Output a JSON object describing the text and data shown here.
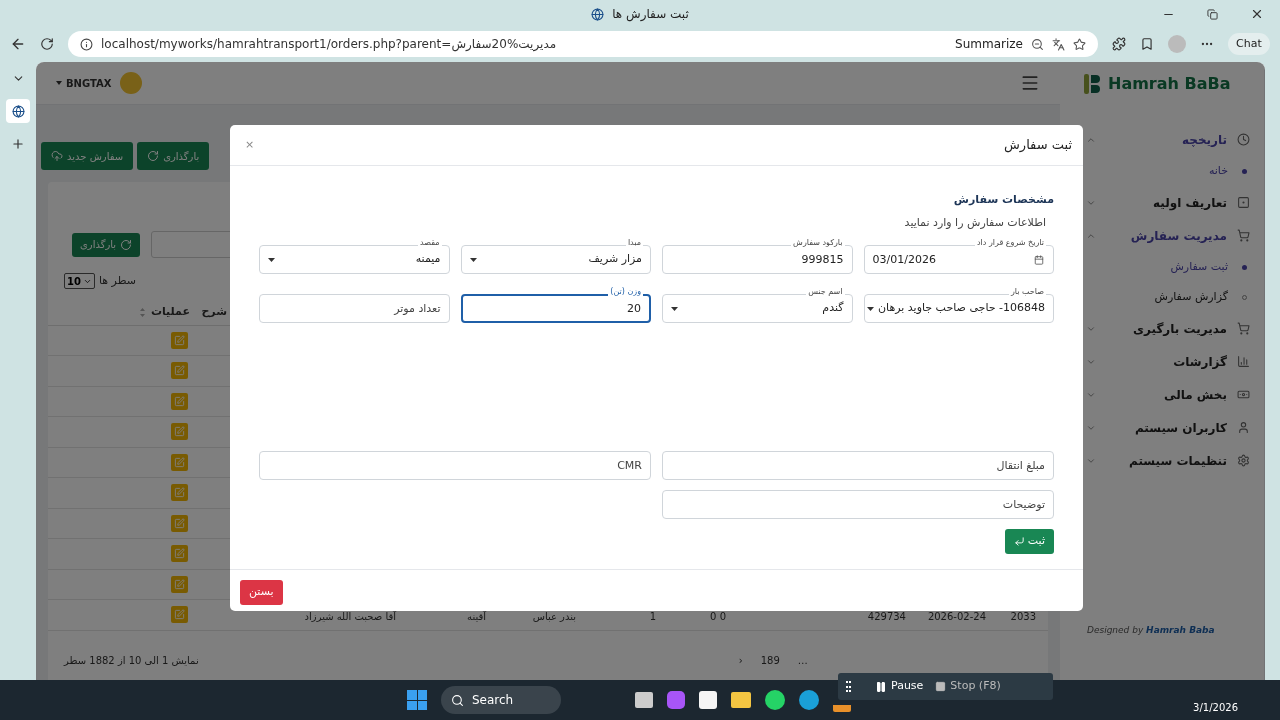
{
  "browser": {
    "title": "ثبت سفارش ها",
    "url": "localhost/myworks/hamrahtransport1/orders.php?parent=مدیریت%20سفارش",
    "summarize": "Summarize",
    "chat": "Chat"
  },
  "header": {
    "user": "BNGTAX",
    "logo": "Hamrah BaBa"
  },
  "toolbar": {
    "buttons": [
      {
        "label": "بارگذاری",
        "kind": "reload"
      },
      {
        "label": "سفارش جدید",
        "kind": "new"
      }
    ]
  },
  "table_controls": {
    "reload": "بارگذاری",
    "rows_per_page": "10",
    "rows_label": "سطر ها"
  },
  "table": {
    "columns": [
      {
        "label": "شرح"
      },
      {
        "label": "عملیات"
      }
    ],
    "rows": [
      {
        "kind": "edit"
      },
      {
        "kind": "edit"
      },
      {
        "kind": "edit"
      },
      {
        "kind": "edit"
      },
      {
        "kind": "edit"
      },
      {
        "kind": "edit"
      },
      {
        "kind": "edit"
      },
      {
        "kind": "edit"
      },
      {
        "kind": "edit"
      },
      {
        "kind": "edit",
        "cells": [
          "2033",
          "2026-02-24",
          "429734",
          "0 0",
          "1",
          "بندر عباس",
          "آقینه",
          "آقا صحبت الله شیرزاد"
        ]
      }
    ],
    "summary": "نمایش 1 الی 10 از 1882 سطر",
    "pagination": [
      "…",
      "189",
      "›"
    ]
  },
  "sidebar": {
    "items": [
      {
        "label": "تاریخچه",
        "expanded": true,
        "selected": true,
        "children": [
          {
            "label": "خانه",
            "selected": true
          }
        ]
      },
      {
        "label": "تعاریف اولیه",
        "expanded": false,
        "selected": false
      },
      {
        "label": "مدیریت سفارش",
        "expanded": true,
        "selected": true,
        "children": [
          {
            "label": "ثبت سفارش",
            "selected": true
          },
          {
            "label": "گزارش سفارش",
            "selected": false
          }
        ]
      },
      {
        "label": "مدیریت بارگیری",
        "expanded": false,
        "selected": false
      },
      {
        "label": "گزارشات",
        "expanded": false,
        "selected": false
      },
      {
        "label": "بخش مالی",
        "expanded": false,
        "selected": false
      },
      {
        "label": "کاربران سیستم",
        "expanded": false,
        "selected": false
      },
      {
        "label": "تنظیمات سیستم",
        "expanded": false,
        "selected": false
      }
    ],
    "footer_prefix": "Designed by",
    "footer_brand": "Hamrah Baba"
  },
  "modal": {
    "title": "ثبت سفارش",
    "close_icon": "×",
    "section": "مشخصات سفارش",
    "subtitle": "اطلاعات سفارش را وارد نمایید",
    "grid": [
      [
        {
          "kind": "date",
          "label": "تاریخ شروع قرار داد",
          "value": "03/01/2026",
          "focused": false
        },
        {
          "kind": "input",
          "label": "بارکود سفارش",
          "value": "999815",
          "focused": false
        },
        {
          "kind": "select",
          "label": "مبدا",
          "value": "مزار شریف",
          "focused": false
        },
        {
          "kind": "select",
          "label": "مقصد",
          "value": "میمنه",
          "focused": false
        }
      ],
      [
        {
          "kind": "select",
          "label": "صاحب بار",
          "value": "106848- حاجی صاحب جاوید برهان",
          "focused": false
        },
        {
          "kind": "select",
          "label": "اسم جنس",
          "value": "گندم",
          "focused": false
        },
        {
          "kind": "input",
          "label": "وزن (تن)",
          "value": "20",
          "focused": true
        },
        {
          "kind": "input",
          "placeholder": "تعداد موتر",
          "focused": false
        }
      ]
    ],
    "wide_grid": [
      [
        {
          "kind": "input",
          "placeholder": "مبلغ انتقال",
          "focused": false
        },
        {
          "kind": "input",
          "placeholder": "CMR",
          "focused": false
        }
      ],
      [
        {
          "kind": "input",
          "placeholder": "توضیحات",
          "focused": false
        }
      ]
    ],
    "submit": "ثبت",
    "close": "بستن"
  },
  "recorder": {
    "pause": "Pause",
    "stop": "Stop (F8)"
  },
  "taskbar": {
    "search": "Search",
    "date": "3/1/2026"
  }
}
